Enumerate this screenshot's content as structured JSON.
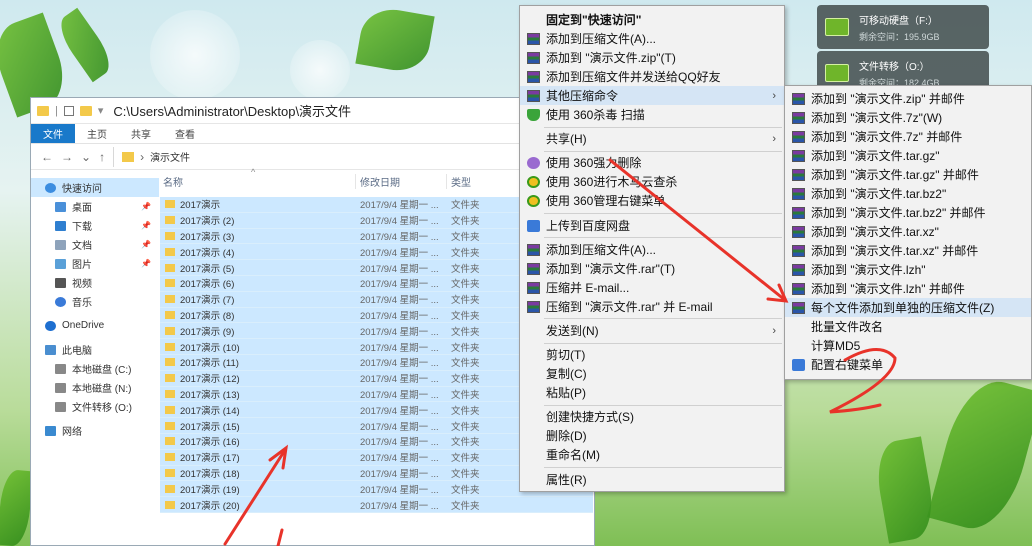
{
  "drives": [
    {
      "name": "可移动硬盘（F:）",
      "free": "剩余空间：195.9GB"
    },
    {
      "name": "文件转移（O:）",
      "free": "剩余空间：182.4GB"
    }
  ],
  "explorer": {
    "title_path": "C:\\Users\\Administrator\\Desktop\\演示文件",
    "ribbon_tabs": [
      "文件",
      "主页",
      "共享",
      "查看"
    ],
    "address": "演示文件",
    "columns": {
      "name": "名称",
      "date": "修改日期",
      "type": "类型"
    },
    "nav_items": [
      {
        "label": "快速访问",
        "icon": "star-icon"
      },
      {
        "label": "桌面",
        "icon": "desktop-icon",
        "pinned": true
      },
      {
        "label": "下载",
        "icon": "download-icon",
        "pinned": true
      },
      {
        "label": "文档",
        "icon": "document-icon",
        "pinned": true
      },
      {
        "label": "图片",
        "icon": "picture-icon",
        "pinned": true
      },
      {
        "label": "视频",
        "icon": "video-icon"
      },
      {
        "label": "音乐",
        "icon": "music-icon"
      },
      {
        "label": "OneDrive",
        "icon": "cloud-icon"
      },
      {
        "label": "此电脑",
        "icon": "computer-icon"
      },
      {
        "label": "本地磁盘 (C:)",
        "icon": "drive-icon"
      },
      {
        "label": "本地磁盘 (N:)",
        "icon": "drive-icon"
      },
      {
        "label": "文件转移 (O:)",
        "icon": "drive-icon"
      },
      {
        "label": "网络",
        "icon": "network-icon"
      }
    ],
    "files": [
      {
        "name": "2017演示",
        "date": "2017/9/4 星期一 ...",
        "type": "文件夹"
      },
      {
        "name": "2017演示 (2)",
        "date": "2017/9/4 星期一 ...",
        "type": "文件夹"
      },
      {
        "name": "2017演示 (3)",
        "date": "2017/9/4 星期一 ...",
        "type": "文件夹"
      },
      {
        "name": "2017演示 (4)",
        "date": "2017/9/4 星期一 ...",
        "type": "文件夹"
      },
      {
        "name": "2017演示 (5)",
        "date": "2017/9/4 星期一 ...",
        "type": "文件夹"
      },
      {
        "name": "2017演示 (6)",
        "date": "2017/9/4 星期一 ...",
        "type": "文件夹"
      },
      {
        "name": "2017演示 (7)",
        "date": "2017/9/4 星期一 ...",
        "type": "文件夹"
      },
      {
        "name": "2017演示 (8)",
        "date": "2017/9/4 星期一 ...",
        "type": "文件夹"
      },
      {
        "name": "2017演示 (9)",
        "date": "2017/9/4 星期一 ...",
        "type": "文件夹"
      },
      {
        "name": "2017演示 (10)",
        "date": "2017/9/4 星期一 ...",
        "type": "文件夹"
      },
      {
        "name": "2017演示 (11)",
        "date": "2017/9/4 星期一 ...",
        "type": "文件夹"
      },
      {
        "name": "2017演示 (12)",
        "date": "2017/9/4 星期一 ...",
        "type": "文件夹"
      },
      {
        "name": "2017演示 (13)",
        "date": "2017/9/4 星期一 ...",
        "type": "文件夹"
      },
      {
        "name": "2017演示 (14)",
        "date": "2017/9/4 星期一 ...",
        "type": "文件夹"
      },
      {
        "name": "2017演示 (15)",
        "date": "2017/9/4 星期一 ...",
        "type": "文件夹"
      },
      {
        "name": "2017演示 (16)",
        "date": "2017/9/4 星期一 ...",
        "type": "文件夹"
      },
      {
        "name": "2017演示 (17)",
        "date": "2017/9/4 星期一 ...",
        "type": "文件夹"
      },
      {
        "name": "2017演示 (18)",
        "date": "2017/9/4 星期一 ...",
        "type": "文件夹"
      },
      {
        "name": "2017演示 (19)",
        "date": "2017/9/4 星期一 ...",
        "type": "文件夹"
      },
      {
        "name": "2017演示 (20)",
        "date": "2017/9/4 星期一 ...",
        "type": "文件夹"
      }
    ]
  },
  "context_menu": [
    {
      "label": "固定到\"快速访问\"",
      "icon": "",
      "bold": true
    },
    {
      "label": "添加到压缩文件(A)...",
      "icon": "winrar-icon"
    },
    {
      "label": "添加到 \"演示文件.zip\"(T)",
      "icon": "winrar-icon"
    },
    {
      "label": "添加到压缩文件并发送给QQ好友",
      "icon": "winrar-icon"
    },
    {
      "label": "其他压缩命令",
      "icon": "winrar-icon",
      "submenu": true,
      "hover": true
    },
    {
      "label": "使用 360杀毒 扫描",
      "icon": "shield-icon"
    },
    {
      "separator": true
    },
    {
      "label": "共享(H)",
      "icon": "",
      "submenu": true
    },
    {
      "separator": true
    },
    {
      "label": "使用 360强力删除",
      "icon": "delete-icon"
    },
    {
      "label": "使用 360进行木马云查杀",
      "icon": "360-icon"
    },
    {
      "label": "使用 360管理右键菜单",
      "icon": "360-icon"
    },
    {
      "separator": true
    },
    {
      "label": "上传到百度网盘",
      "icon": "cloud-upload-icon"
    },
    {
      "separator": true
    },
    {
      "label": "添加到压缩文件(A)...",
      "icon": "winrar-icon"
    },
    {
      "label": "添加到 \"演示文件.rar\"(T)",
      "icon": "winrar-icon"
    },
    {
      "label": "压缩并 E-mail...",
      "icon": "winrar-icon"
    },
    {
      "label": "压缩到 \"演示文件.rar\" 并 E-mail",
      "icon": "winrar-icon"
    },
    {
      "separator": true
    },
    {
      "label": "发送到(N)",
      "icon": "",
      "submenu": true
    },
    {
      "separator": true
    },
    {
      "label": "剪切(T)",
      "icon": ""
    },
    {
      "label": "复制(C)",
      "icon": ""
    },
    {
      "label": "粘贴(P)",
      "icon": ""
    },
    {
      "separator": true
    },
    {
      "label": "创建快捷方式(S)",
      "icon": ""
    },
    {
      "label": "删除(D)",
      "icon": ""
    },
    {
      "label": "重命名(M)",
      "icon": ""
    },
    {
      "separator": true
    },
    {
      "label": "属性(R)",
      "icon": ""
    }
  ],
  "submenu": [
    {
      "label": "添加到 \"演示文件.zip\" 并邮件",
      "icon": "winrar-icon"
    },
    {
      "label": "添加到 \"演示文件.7z\"(W)",
      "icon": "winrar-icon"
    },
    {
      "label": "添加到 \"演示文件.7z\" 并邮件",
      "icon": "winrar-icon"
    },
    {
      "label": "添加到 \"演示文件.tar.gz\"",
      "icon": "winrar-icon"
    },
    {
      "label": "添加到 \"演示文件.tar.gz\" 并邮件",
      "icon": "winrar-icon"
    },
    {
      "label": "添加到 \"演示文件.tar.bz2\"",
      "icon": "winrar-icon"
    },
    {
      "label": "添加到 \"演示文件.tar.bz2\" 并邮件",
      "icon": "winrar-icon"
    },
    {
      "label": "添加到 \"演示文件.tar.xz\"",
      "icon": "winrar-icon"
    },
    {
      "label": "添加到 \"演示文件.tar.xz\" 并邮件",
      "icon": "winrar-icon"
    },
    {
      "label": "添加到 \"演示文件.lzh\"",
      "icon": "winrar-icon"
    },
    {
      "label": "添加到 \"演示文件.lzh\" 并邮件",
      "icon": "winrar-icon"
    },
    {
      "label": "每个文件添加到单独的压缩文件(Z)",
      "icon": "winrar-icon",
      "hover": true
    },
    {
      "label": "批量文件改名",
      "icon": ""
    },
    {
      "label": "计算MD5",
      "icon": ""
    },
    {
      "label": "配置右键菜单",
      "icon": "settings-icon"
    }
  ],
  "annotations": {
    "arrow_color": "#e8332a"
  }
}
